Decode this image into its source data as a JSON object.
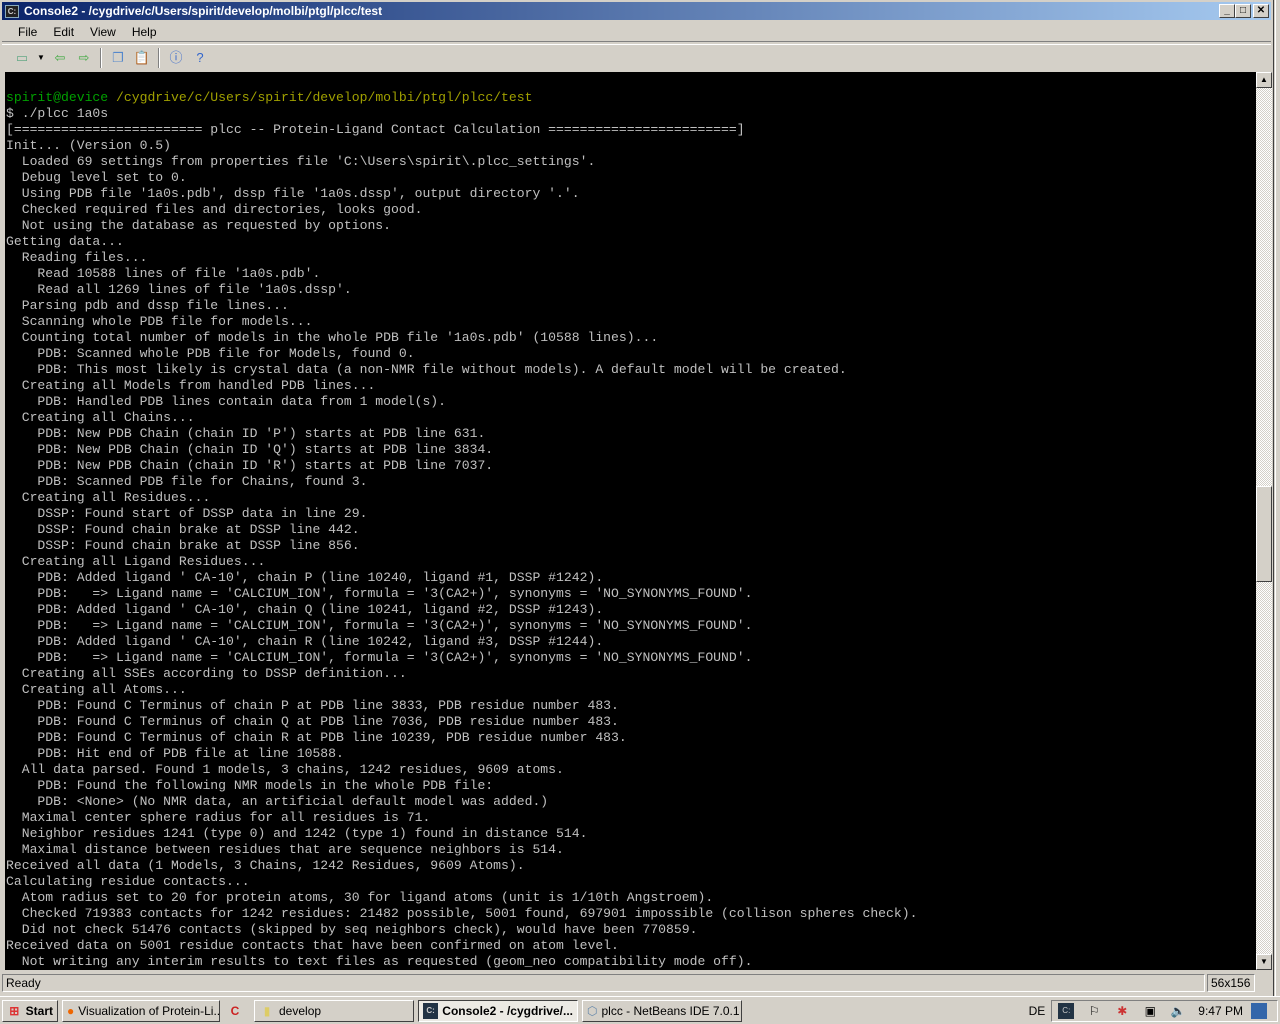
{
  "window": {
    "title": "Console2 - /cygdrive/c/Users/spirit/develop/molbi/ptgl/plcc/test"
  },
  "menu": [
    "File",
    "Edit",
    "View",
    "Help"
  ],
  "toolbar_icons": [
    "new-tab-icon",
    "dropdown-arrow-icon",
    "previous-tab-icon",
    "next-tab-icon",
    "copy-icon",
    "paste-icon",
    "info-icon",
    "help-icon"
  ],
  "console": {
    "prompt_user": "spirit@device",
    "prompt_path": "/cygdrive/c/Users/spirit/develop/molbi/ptgl/plcc/test",
    "lines": [
      "$ ./plcc 1a0s",
      "[======================== plcc -- Protein-Ligand Contact Calculation ========================]",
      "Init... (Version 0.5)",
      "  Loaded 69 settings from properties file 'C:\\Users\\spirit\\.plcc_settings'.",
      "  Debug level set to 0.",
      "  Using PDB file '1a0s.pdb', dssp file '1a0s.dssp', output directory '.'.",
      "  Checked required files and directories, looks good.",
      "  Not using the database as requested by options.",
      "Getting data...",
      "  Reading files...",
      "    Read 10588 lines of file '1a0s.pdb'.",
      "    Read all 1269 lines of file '1a0s.dssp'.",
      "  Parsing pdb and dssp file lines...",
      "  Scanning whole PDB file for models...",
      "  Counting total number of models in the whole PDB file '1a0s.pdb' (10588 lines)...",
      "    PDB: Scanned whole PDB file for Models, found 0.",
      "    PDB: This most likely is crystal data (a non-NMR file without models). A default model will be created.",
      "  Creating all Models from handled PDB lines...",
      "    PDB: Handled PDB lines contain data from 1 model(s).",
      "  Creating all Chains...",
      "    PDB: New PDB Chain (chain ID 'P') starts at PDB line 631.",
      "    PDB: New PDB Chain (chain ID 'Q') starts at PDB line 3834.",
      "    PDB: New PDB Chain (chain ID 'R') starts at PDB line 7037.",
      "    PDB: Scanned PDB file for Chains, found 3.",
      "  Creating all Residues...",
      "    DSSP: Found start of DSSP data in line 29.",
      "    DSSP: Found chain brake at DSSP line 442.",
      "    DSSP: Found chain brake at DSSP line 856.",
      "  Creating all Ligand Residues...",
      "    PDB: Added ligand ' CA-10', chain P (line 10240, ligand #1, DSSP #1242).",
      "    PDB:   => Ligand name = 'CALCIUM_ION', formula = '3(CA2+)', synonyms = 'NO_SYNONYMS_FOUND'.",
      "    PDB: Added ligand ' CA-10', chain Q (line 10241, ligand #2, DSSP #1243).",
      "    PDB:   => Ligand name = 'CALCIUM_ION', formula = '3(CA2+)', synonyms = 'NO_SYNONYMS_FOUND'.",
      "    PDB: Added ligand ' CA-10', chain R (line 10242, ligand #3, DSSP #1244).",
      "    PDB:   => Ligand name = 'CALCIUM_ION', formula = '3(CA2+)', synonyms = 'NO_SYNONYMS_FOUND'.",
      "  Creating all SSEs according to DSSP definition...",
      "  Creating all Atoms...",
      "    PDB: Found C Terminus of chain P at PDB line 3833, PDB residue number 483.",
      "    PDB: Found C Terminus of chain Q at PDB line 7036, PDB residue number 483.",
      "    PDB: Found C Terminus of chain R at PDB line 10239, PDB residue number 483.",
      "    PDB: Hit end of PDB file at line 10588.",
      "  All data parsed. Found 1 models, 3 chains, 1242 residues, 9609 atoms.",
      "    PDB: Found the following NMR models in the whole PDB file:",
      "    PDB: <None> (No NMR data, an artificial default model was added.)",
      "  Maximal center sphere radius for all residues is 71.",
      "  Neighbor residues 1241 (type 0) and 1242 (type 1) found in distance 514.",
      "  Maximal distance between residues that are sequence neighbors is 514.",
      "Received all data (1 Models, 3 Chains, 1242 Residues, 9609 Atoms).",
      "Calculating residue contacts...",
      "  Atom radius set to 20 for protein atoms, 30 for ligand atoms (unit is 1/10th Angstroem).",
      "  Checked 719383 contacts for 1242 residues: 21482 possible, 5001 found, 697901 impossible (collison spheres check).",
      "  Did not check 51476 contacts (skipped by seq neighbors check), would have been 770859.",
      "Received data on 5001 residue contacts that have been confirmed on atom level.",
      "  Not writing any interim results to text files as requested (geom_neo compatibility mode off)."
    ]
  },
  "statusbar": {
    "text": "Ready",
    "size": "56x156"
  },
  "taskbar": {
    "start": "Start",
    "tasks": [
      {
        "label": "Visualization of Protein-Li...",
        "icon": "firefox-icon"
      },
      {
        "label": "",
        "icon": "ccleaner-icon"
      },
      {
        "label": "develop",
        "icon": "folder-icon"
      },
      {
        "label": "Console2 - /cygdrive/...",
        "icon": "console-icon",
        "active": true
      },
      {
        "label": "plcc - NetBeans IDE 7.0.1",
        "icon": "netbeans-icon"
      }
    ],
    "language": "DE",
    "clock": "9:47 PM"
  },
  "colors": {
    "prompt_user": "#00a000",
    "prompt_path": "#a0a000",
    "console_text": "#c0c0c0",
    "console_bg": "#000000"
  }
}
